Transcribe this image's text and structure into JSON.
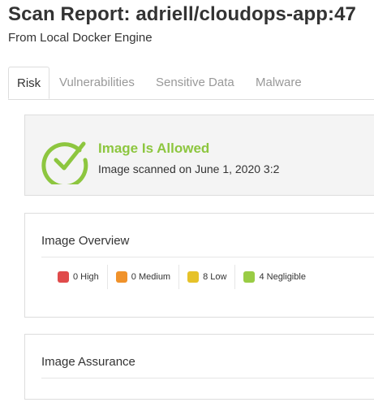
{
  "header": {
    "title": "Scan Report: adriell/cloudops-app:47",
    "subtitle": "From Local Docker Engine"
  },
  "tabs": [
    {
      "label": "Risk",
      "active": true
    },
    {
      "label": "Vulnerabilities",
      "active": false
    },
    {
      "label": "Sensitive Data",
      "active": false
    },
    {
      "label": "Malware",
      "active": false
    }
  ],
  "status": {
    "icon": "check-circle-icon",
    "title": "Image Is Allowed",
    "text": "Image scanned on June 1, 2020 3:2",
    "color": "#8dc63f"
  },
  "overview": {
    "heading": "Image Overview",
    "counts": [
      {
        "label": "0 High",
        "color": "#e04b4b"
      },
      {
        "label": "0 Medium",
        "color": "#f0922b"
      },
      {
        "label": "8 Low",
        "color": "#e6c229"
      },
      {
        "label": "4 Negligible",
        "color": "#99cc44"
      }
    ]
  },
  "assurance": {
    "heading": "Image Assurance"
  }
}
